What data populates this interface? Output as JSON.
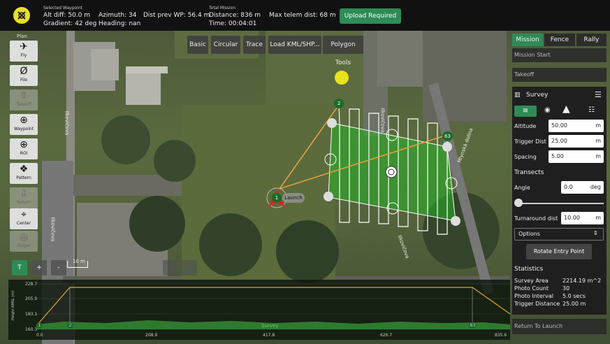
{
  "topbar": {
    "selected_waypoint_title": "Selected Waypoint",
    "alt_diff": "Alt diff:   50.0 m",
    "gradient": "Gradient:  42 deg",
    "azimuth": "Azimuth:  34",
    "heading": "Heading:  nan",
    "dist_prev": "Dist prev WP:  56.4 m",
    "total_mission_title": "Total Mission",
    "distance": "Distance:  836 m",
    "time": "Time:        00:04:01",
    "max_telem": "Max telem dist:  68 m",
    "upload_button": "Upload Required"
  },
  "toolbar": {
    "plan_label": "Plan",
    "items": [
      {
        "label": "Fly",
        "icon": "plane-icon",
        "enabled": true
      },
      {
        "label": "File",
        "icon": "file-icon",
        "enabled": true
      },
      {
        "label": "Takeoff",
        "icon": "takeoff-icon",
        "enabled": false
      },
      {
        "label": "Waypoint",
        "icon": "plus-circle-icon",
        "enabled": true
      },
      {
        "label": "ROI",
        "icon": "plus-circle-icon",
        "enabled": true
      },
      {
        "label": "Pattern",
        "icon": "pattern-icon",
        "enabled": true
      },
      {
        "label": "Return",
        "icon": "return-icon",
        "enabled": false
      },
      {
        "label": "Center",
        "icon": "crosshair-icon",
        "enabled": true
      },
      {
        "label": "Target",
        "icon": "target-icon",
        "enabled": false
      }
    ]
  },
  "map_buttons": [
    "Basic",
    "Circular",
    "Trace",
    "Load KML/SHP...",
    "Polygon Tools"
  ],
  "map_labels": {
    "street_1": "Ilkovičova",
    "street_2": "Ilkovičova",
    "street_3": "Ilkovičova",
    "street_4": "Mlynská dolina",
    "street_5": "Ilkovičova",
    "launch": "Launch",
    "wp_2": "2",
    "wp_63": "63",
    "wp_1": "1",
    "scale": "10 m",
    "zoom_t": "T",
    "zoom_plus": "+",
    "zoom_minus": "-"
  },
  "right_panel": {
    "tabs": [
      "Mission",
      "Fence",
      "Rally"
    ],
    "mission_start": "Mission Start",
    "takeoff": "Takeoff",
    "survey_title": "Survey",
    "altitude_label": "Altitude",
    "altitude_value": "50.00",
    "altitude_unit": "m",
    "trigger_label": "Trigger Dist",
    "trigger_value": "25.00",
    "trigger_unit": "m",
    "spacing_label": "Spacing",
    "spacing_value": "5.00",
    "spacing_unit": "m",
    "transects_label": "Transects",
    "angle_label": "Angle",
    "angle_value": "0.0",
    "angle_unit": "deg",
    "turnaround_label": "Turnaround dist",
    "turnaround_value": "10.00",
    "turnaround_unit": "m",
    "options_label": "Options",
    "rotate_button": "Rotate Entry Point",
    "statistics_label": "Statistics",
    "stats": [
      {
        "label": "Survey Area",
        "value": "2214.19 m^2"
      },
      {
        "label": "Photo Count",
        "value": "30"
      },
      {
        "label": "Photo Interval",
        "value": "5.0 secs"
      },
      {
        "label": "Trigger Distance",
        "value": "25.00 m"
      }
    ],
    "return_to_launch": "Return To Launch"
  },
  "elevation": {
    "y_axis_label": "Height AMSL (m)",
    "y_ticks": [
      "228.7",
      "205.9",
      "183.1",
      "160.3"
    ],
    "x_ticks": [
      "0.0",
      "208.9",
      "417.8",
      "626.7",
      "835.6"
    ],
    "survey_label": "Survey",
    "wp_labels": [
      "1",
      "2",
      "63"
    ]
  }
}
